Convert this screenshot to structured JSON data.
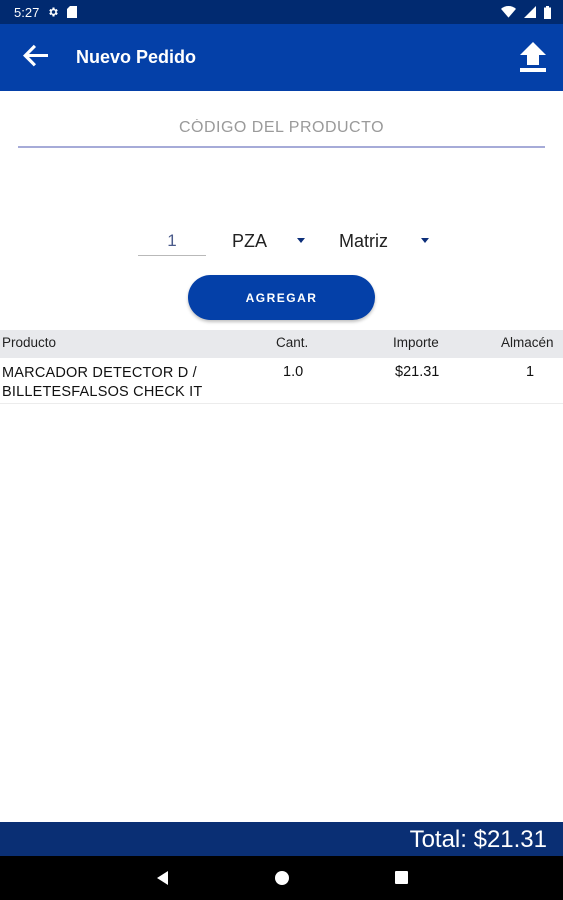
{
  "status_bar": {
    "time": "5:27",
    "icons": [
      "settings-icon",
      "sd-card-icon",
      "wifi-icon",
      "signal-icon",
      "battery-icon"
    ]
  },
  "app_bar": {
    "title": "Nuevo Pedido",
    "icons": [
      "back-arrow-icon",
      "upload-icon"
    ],
    "color": "#0440a8"
  },
  "product_code": {
    "placeholder": "CÓDIGO DEL PRODUCTO",
    "value": ""
  },
  "quantity": {
    "value": "1"
  },
  "unit_select": {
    "selected": "PZA"
  },
  "store_select": {
    "selected": "Matriz"
  },
  "add_button": {
    "label": "AGREGAR"
  },
  "table": {
    "headers": {
      "product": "Producto",
      "quantity": "Cant.",
      "amount": "Importe",
      "warehouse": "Almacén"
    },
    "rows": [
      {
        "product": "MARCADOR DETECTOR D / BILLETESFALSOS CHECK IT",
        "quantity": "1.0",
        "amount": "$21.31",
        "warehouse": "1"
      }
    ]
  },
  "total": {
    "label": "Total: $21.31"
  },
  "nav_bar": {
    "icons": [
      "nav-back-icon",
      "nav-home-icon",
      "nav-recents-icon"
    ]
  }
}
